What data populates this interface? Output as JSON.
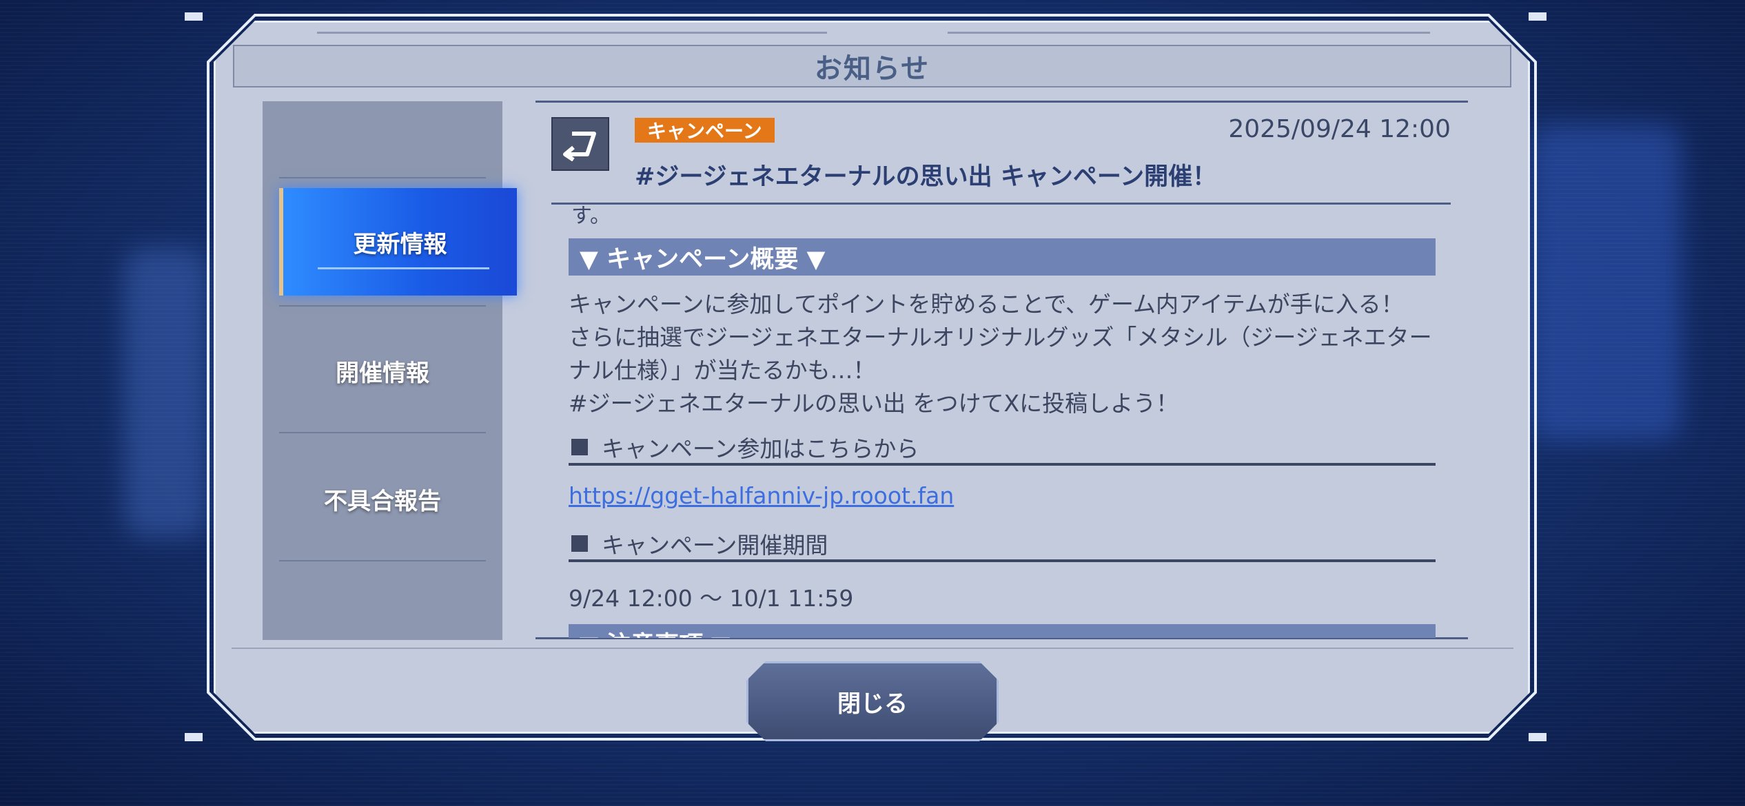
{
  "dialog": {
    "title": "お知らせ",
    "close_label": "閉じる"
  },
  "sidebar": {
    "items": [
      {
        "label": "更新情報",
        "active": true
      },
      {
        "label": "開催情報",
        "active": false
      },
      {
        "label": "不具合報告",
        "active": false
      }
    ]
  },
  "post": {
    "icon": "return-arrow-icon",
    "category": "キャンペーン",
    "category_color": "#e47818",
    "date": "2025/09/24 12:00",
    "title": "#ジージェネエターナルの思い出 キャンペーン開催！",
    "fragment_top": "す。",
    "section_overview": "▼ キャンペーン概要 ▼",
    "overview_lines": [
      "キャンペーンに参加してポイントを貯めることで、ゲーム内アイテムが手に入る！",
      "さらに抽選でジージェネエターナルオリジナルグッズ「メタシル（ジージェネエター",
      "ナル仕様）」が当たるかも…！",
      "#ジージェネエターナルの思い出 をつけてXに投稿しよう！"
    ],
    "join_heading": "キャンペーン参加はこちらから",
    "join_link": "https://gget-halfanniv-jp.rooot.fan",
    "period_heading": "キャンペーン開催期間",
    "period_value": "9/24 12:00 ～ 10/1 11:59",
    "section_notes": "▼ 注意事項 ▼"
  },
  "colors": {
    "active_tab": "#1a5be6",
    "section_header": "#6f84b5",
    "link": "#3c6ee0"
  }
}
